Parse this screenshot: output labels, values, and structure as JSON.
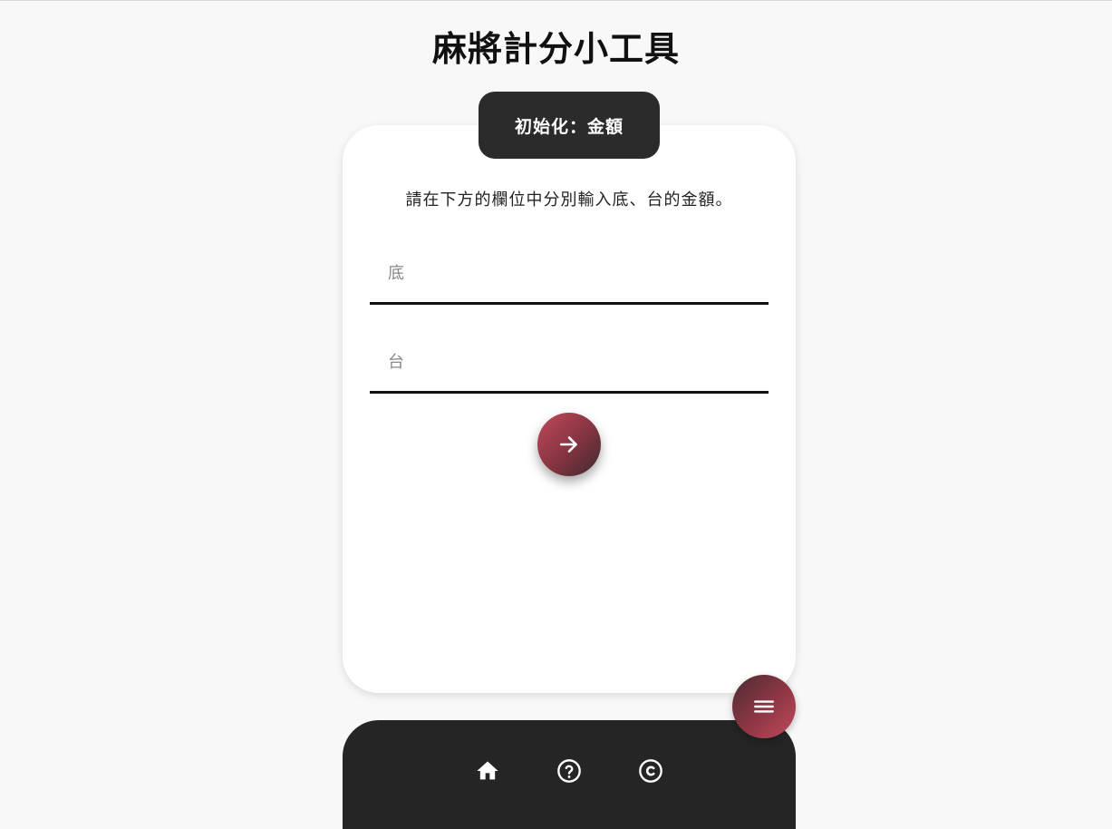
{
  "app": {
    "title": "麻將計分小工具"
  },
  "card": {
    "step_label": "初始化：金額",
    "instruction": "請在下方的欄位中分別輸入底、台的金額。",
    "fields": [
      {
        "placeholder": "底",
        "value": ""
      },
      {
        "placeholder": "台",
        "value": ""
      }
    ],
    "next_icon": "arrow-right-icon"
  },
  "fab": {
    "icon": "menu-icon"
  },
  "bottom_nav": {
    "items": [
      {
        "icon": "home-icon"
      },
      {
        "icon": "help-circle-icon"
      },
      {
        "icon": "copyright-icon"
      }
    ]
  },
  "colors": {
    "background": "#f8f8f8",
    "card": "#ffffff",
    "dark": "#252525",
    "accent_start": "#c04a5a",
    "accent_end": "#3f2a2e"
  }
}
